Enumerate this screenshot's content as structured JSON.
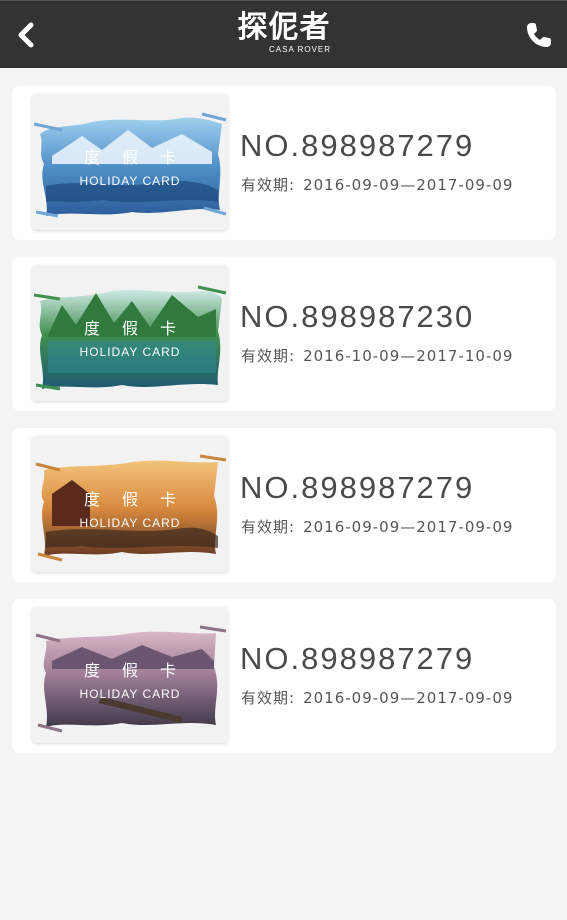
{
  "header": {
    "logo_cn": "探伲者",
    "logo_en": "CASA ROVER",
    "back_icon": "chevron-left-icon",
    "phone_icon": "phone-icon",
    "background": "#333333"
  },
  "cards": [
    {
      "thumb_cn": "度假卡",
      "thumb_en": "HOLIDAY CARD",
      "thumb_scene": "snowy-mountains",
      "number": "NO.898987279",
      "validity_label": "有效期:",
      "validity_range": "2016-09-09—2017-09-09"
    },
    {
      "thumb_cn": "度假卡",
      "thumb_en": "HOLIDAY CARD",
      "thumb_scene": "green-karst-river",
      "number": "NO.898987230",
      "validity_label": "有效期:",
      "validity_range": "2016-10-09—2017-10-09"
    },
    {
      "thumb_cn": "度假卡",
      "thumb_en": "HOLIDAY CARD",
      "thumb_scene": "sunset-town",
      "number": "NO.898987279",
      "validity_label": "有效期:",
      "validity_range": "2016-09-09—2017-09-09"
    },
    {
      "thumb_cn": "度假卡",
      "thumb_en": "HOLIDAY CARD",
      "thumb_scene": "dusk-lake-pier",
      "number": "NO.898987279",
      "validity_label": "有效期:",
      "validity_range": "2016-09-09—2017-09-09"
    }
  ]
}
